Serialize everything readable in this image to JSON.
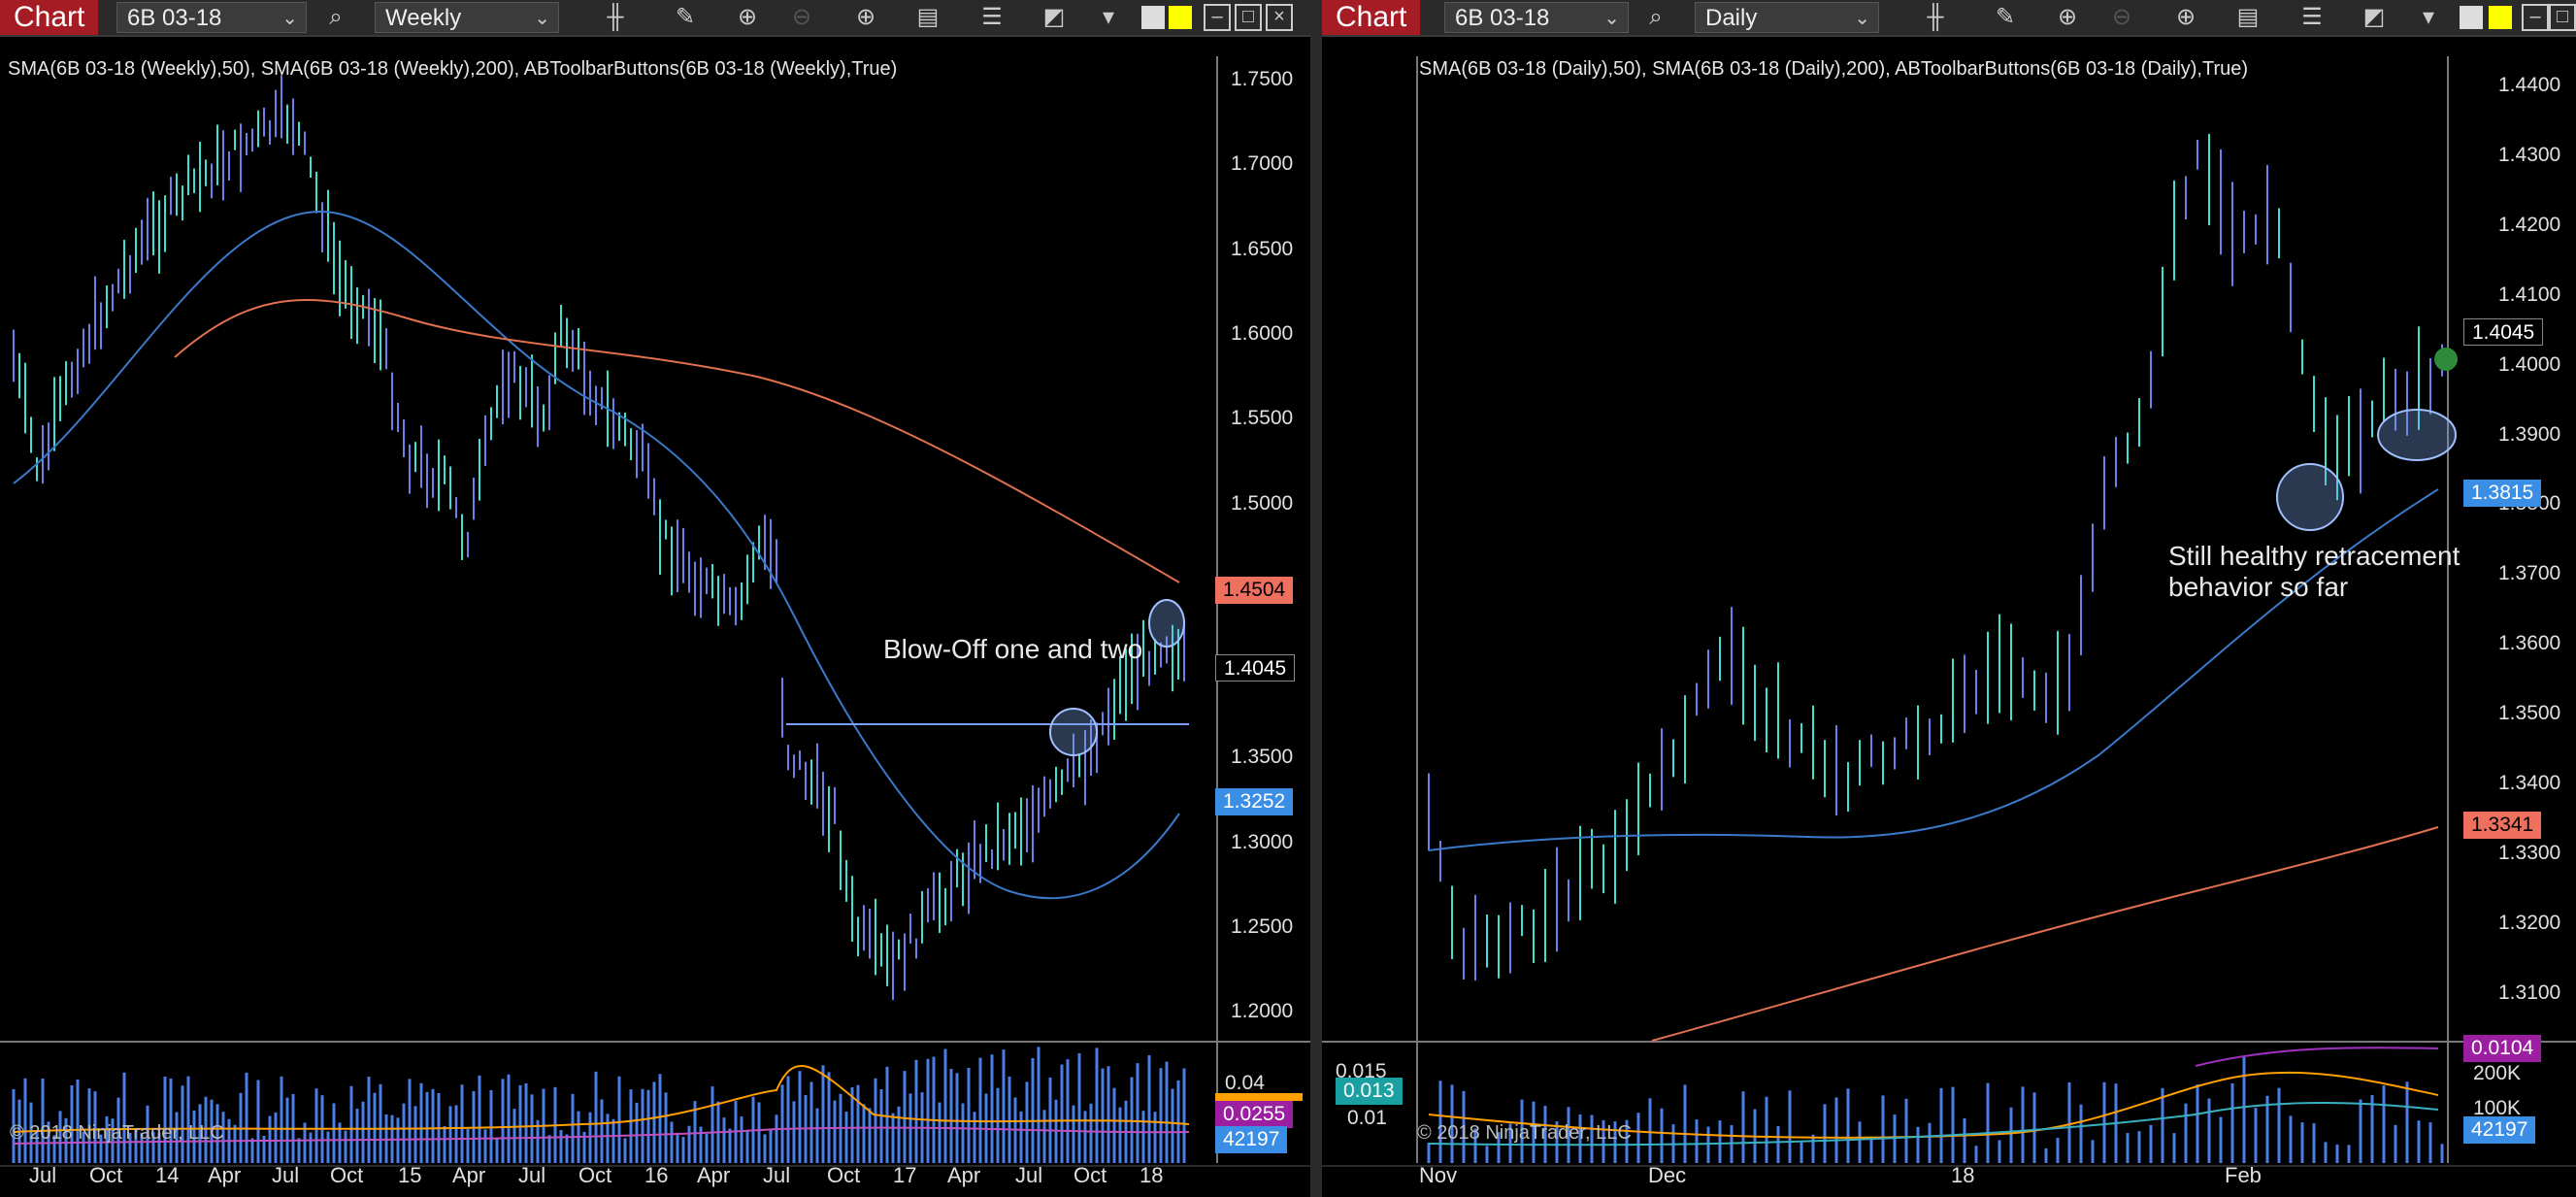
{
  "left": {
    "tab_label": "Chart",
    "instrument": "6B 03-18",
    "period": "Weekly",
    "indicator_label": "SMA(6B 03-18 (Weekly),50), SMA(6B 03-18 (Weekly),200), ABToolbarButtons(6B 03-18 (Weekly),True)",
    "y_ticks": [
      "1.7500",
      "1.7000",
      "1.6500",
      "1.6000",
      "1.5500",
      "1.5000",
      "1.4500",
      "1.4000",
      "1.3500",
      "1.3000",
      "1.2500",
      "1.2000"
    ],
    "price_markers": [
      "1.4504",
      "1.4045",
      "1.3252"
    ],
    "annotation": "Blow-Off one and two",
    "copyright": "© 2018 NinjaTrader, LLC",
    "volume_ticks": [
      "0.04"
    ],
    "volume_markers": [
      "0.0255",
      "42197"
    ],
    "x_labels": [
      "Jul",
      "Oct",
      "14",
      "Apr",
      "Jul",
      "Oct",
      "15",
      "Apr",
      "Jul",
      "Oct",
      "16",
      "Apr",
      "Jul",
      "Oct",
      "17",
      "Apr",
      "Jul",
      "Oct",
      "18"
    ]
  },
  "right": {
    "tab_label": "Chart",
    "instrument": "6B 03-18",
    "period": "Daily",
    "indicator_label": "SMA(6B 03-18 (Daily),50), SMA(6B 03-18 (Daily),200), ABToolbarButtons(6B 03-18 (Daily),True)",
    "y_ticks": [
      "1.4400",
      "1.4300",
      "1.4200",
      "1.4100",
      "1.4000",
      "1.3900",
      "1.3800",
      "1.3700",
      "1.3600",
      "1.3500",
      "1.3400",
      "1.3300",
      "1.3200",
      "1.3100"
    ],
    "price_markers": [
      "1.4045",
      "1.3815",
      "1.3341"
    ],
    "annotation_line1": "Still healthy retracement",
    "annotation_line2": "behavior so far",
    "copyright": "© 2018 NinjaTrader, LLC",
    "volume_ticks_left": [
      "0.015",
      "0.01"
    ],
    "volume_left_marker": "0.013",
    "volume_ticks_right": [
      "200K",
      "100K"
    ],
    "volume_markers": [
      "0.0104",
      "42197"
    ],
    "x_labels": [
      "Nov",
      "Dec",
      "18",
      "Feb"
    ]
  },
  "colors": {
    "accent_tab": "#a51c24",
    "bar_up": "#40e0d0",
    "bar_down": "#6f7fe8",
    "sma50": "#3a78c8",
    "sma200": "#e07050",
    "marker_red": "#f07060",
    "marker_blue": "#3a8ee6"
  }
}
